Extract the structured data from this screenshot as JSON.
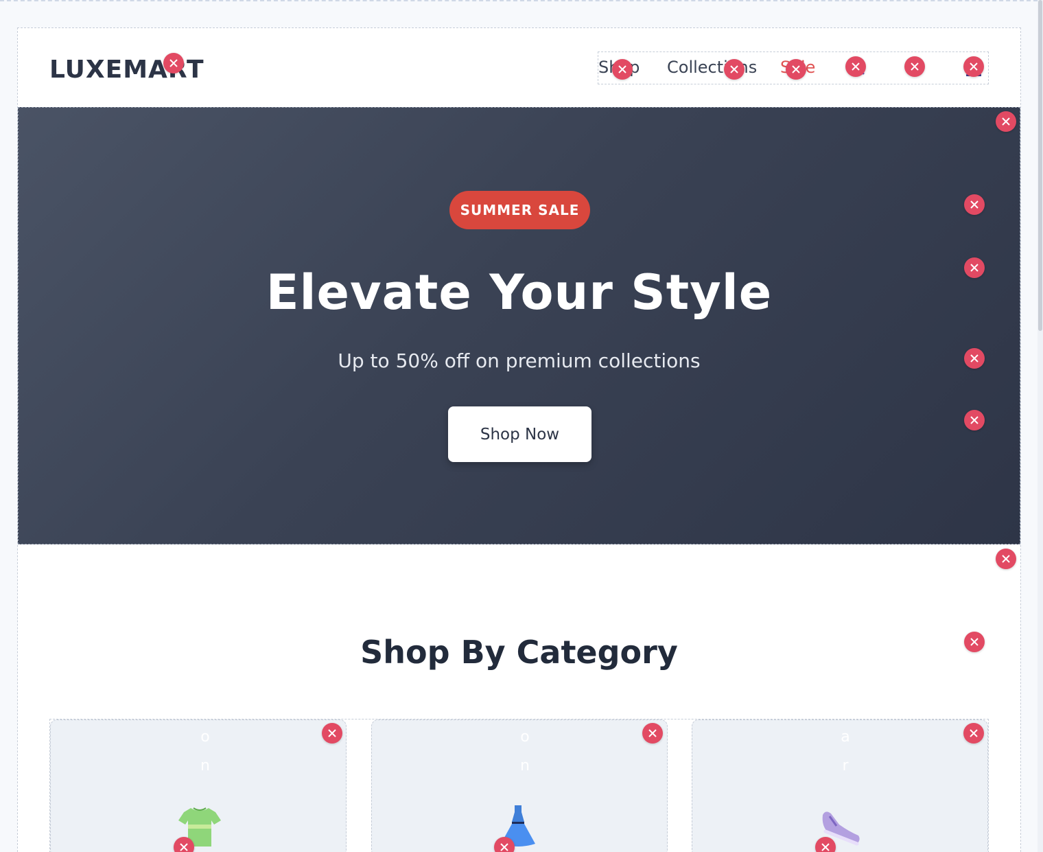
{
  "header": {
    "logo": "LUXEMART",
    "nav": [
      {
        "label": "Shop"
      },
      {
        "label": "Collections"
      },
      {
        "label": "Sale"
      }
    ],
    "icons": [
      "search-icon",
      "cart-icon",
      "user-icon"
    ]
  },
  "hero": {
    "badge": "SUMMER SALE",
    "title": "Elevate Your Style",
    "subtitle": "Up to 50% off on premium collections",
    "cta": "Shop Now"
  },
  "categories": {
    "title": "Shop By Category",
    "cards": [
      {
        "overlay_text": "ion",
        "icon": "tshirt-icon"
      },
      {
        "overlay_text": "ion",
        "icon": "dress-icon"
      },
      {
        "overlay_text": "ear",
        "icon": "sneaker-icon"
      }
    ]
  },
  "colors": {
    "accent": "#d9473d",
    "remove_marker": "#e24a63",
    "hero_bg": "#3a4254",
    "text_dark": "#2c3446"
  }
}
